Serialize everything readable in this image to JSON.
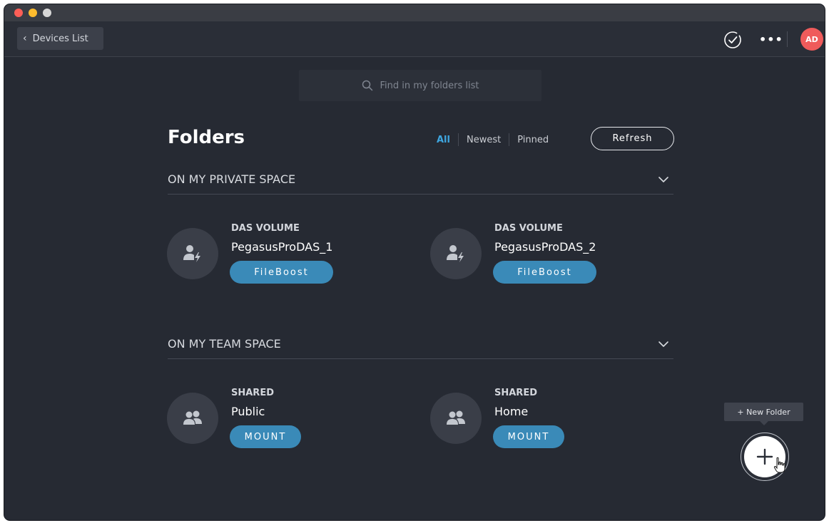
{
  "window": {
    "controls": [
      "close",
      "minimize",
      "zoom"
    ]
  },
  "topbar": {
    "back_label": "Devices List",
    "avatar_initials": "AD",
    "more_icon": "more-horizontal-icon",
    "status_icon": "check-circle-icon"
  },
  "search": {
    "placeholder": "Find in my folders list"
  },
  "page": {
    "title": "Folders",
    "filters": [
      "All",
      "Newest",
      "Pinned"
    ],
    "active_filter": "All",
    "refresh_label": "Refresh"
  },
  "sections": [
    {
      "title": "ON MY PRIVATE SPACE",
      "items": [
        {
          "kind": "DAS VOLUME",
          "name": "PegasusProDAS_1",
          "action": "FileBoost",
          "icon": "user-bolt-icon"
        },
        {
          "kind": "DAS VOLUME",
          "name": "PegasusProDAS_2",
          "action": "FileBoost",
          "icon": "user-bolt-icon"
        }
      ]
    },
    {
      "title": "ON MY TEAM SPACE",
      "items": [
        {
          "kind": "SHARED",
          "name": "Public",
          "action": "MOUNT",
          "icon": "users-icon"
        },
        {
          "kind": "SHARED",
          "name": "Home",
          "action": "MOUNT",
          "icon": "users-icon"
        }
      ]
    }
  ],
  "fab": {
    "tooltip": "+ New Folder",
    "icon": "plus-icon"
  },
  "colors": {
    "background": "#262a33",
    "accent": "#3ea6e0",
    "action_button": "#3a8ab8",
    "avatar": "#ef5b5b"
  }
}
